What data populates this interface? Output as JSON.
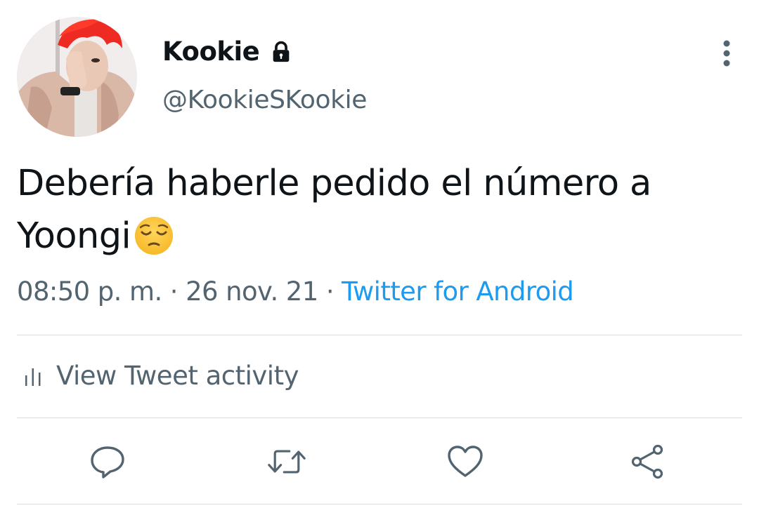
{
  "user": {
    "display_name": "Kookie",
    "handle": "@KookieSKookie",
    "protected_icon": "lock-icon",
    "avatar": "profile photo"
  },
  "tweet": {
    "text": "Debería haberle pedido el número a Yoongi",
    "emoji": "pensive-face-emoji",
    "time": "08:50 p. m.",
    "separator": " · ",
    "date": "26 nov. 21",
    "source": "Twitter for Android"
  },
  "activity": {
    "label": "View Tweet activity",
    "icon": "bar-chart-icon"
  },
  "actions": [
    {
      "name": "reply",
      "icon": "reply-icon"
    },
    {
      "name": "retweet",
      "icon": "retweet-icon"
    },
    {
      "name": "like",
      "icon": "heart-icon"
    },
    {
      "name": "share",
      "icon": "share-icon"
    }
  ],
  "colors": {
    "text": "#0f1419",
    "secondary": "#536471",
    "link": "#1d9bf0",
    "divider": "#d9dde0",
    "icon": "#536471"
  }
}
